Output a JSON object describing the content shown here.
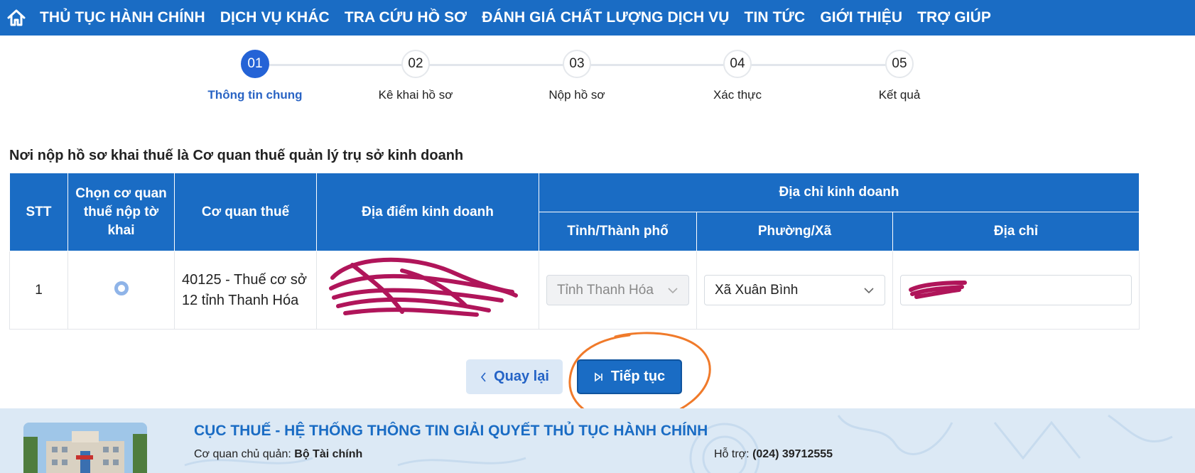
{
  "nav": {
    "home_icon": "home-icon",
    "items": [
      "THỦ TỤC HÀNH CHÍNH",
      "DỊCH VỤ KHÁC",
      "TRA CỨU HỒ SƠ",
      "ĐÁNH GIÁ CHẤT LƯỢNG DỊCH VỤ",
      "TIN TỨC",
      "GIỚI THIỆU",
      "TRỢ GIÚP"
    ]
  },
  "stepper": {
    "active_step": 1,
    "steps": [
      {
        "number": "01",
        "label": "Thông tin chung"
      },
      {
        "number": "02",
        "label": "Kê khai hồ sơ"
      },
      {
        "number": "03",
        "label": "Nộp hồ sơ"
      },
      {
        "number": "04",
        "label": "Xác thực"
      },
      {
        "number": "05",
        "label": "Kết quả"
      }
    ]
  },
  "section": {
    "title": "Nơi nộp hồ sơ khai thuế là Cơ quan thuế quản lý trụ sở kinh doanh"
  },
  "table": {
    "headers": {
      "stt": "STT",
      "choose": "Chọn cơ quan thuế nộp tờ khai",
      "agency": "Cơ quan thuế",
      "location": "Địa điểm kinh doanh",
      "address_group": "Địa chỉ kinh doanh",
      "province": "Tỉnh/Thành phố",
      "ward": "Phường/Xã",
      "address": "Địa chỉ"
    },
    "rows": [
      {
        "stt": "1",
        "selected": true,
        "agency": "40125 - Thuế cơ sở 12 tỉnh Thanh Hóa",
        "province": "Tỉnh Thanh Hóa",
        "ward": "Xã Xuân Bình"
      }
    ]
  },
  "buttons": {
    "back_label": "Quay lại",
    "next_label": "Tiếp tục"
  },
  "footer": {
    "title": "CỤC THUẾ - HỆ THỐNG THÔNG TIN GIẢI QUYẾT THỦ TỤC HÀNH CHÍNH",
    "owner_label": "Cơ quan chủ quản:",
    "owner_value": "Bộ Tài chính",
    "support_label": "Hỗ trợ:",
    "support_value": "(024) 39712555"
  },
  "colors": {
    "primary": "#1a6cc4",
    "active_step": "#2463d6",
    "annotation": "#f07a2a",
    "redaction": "#b0155a"
  }
}
